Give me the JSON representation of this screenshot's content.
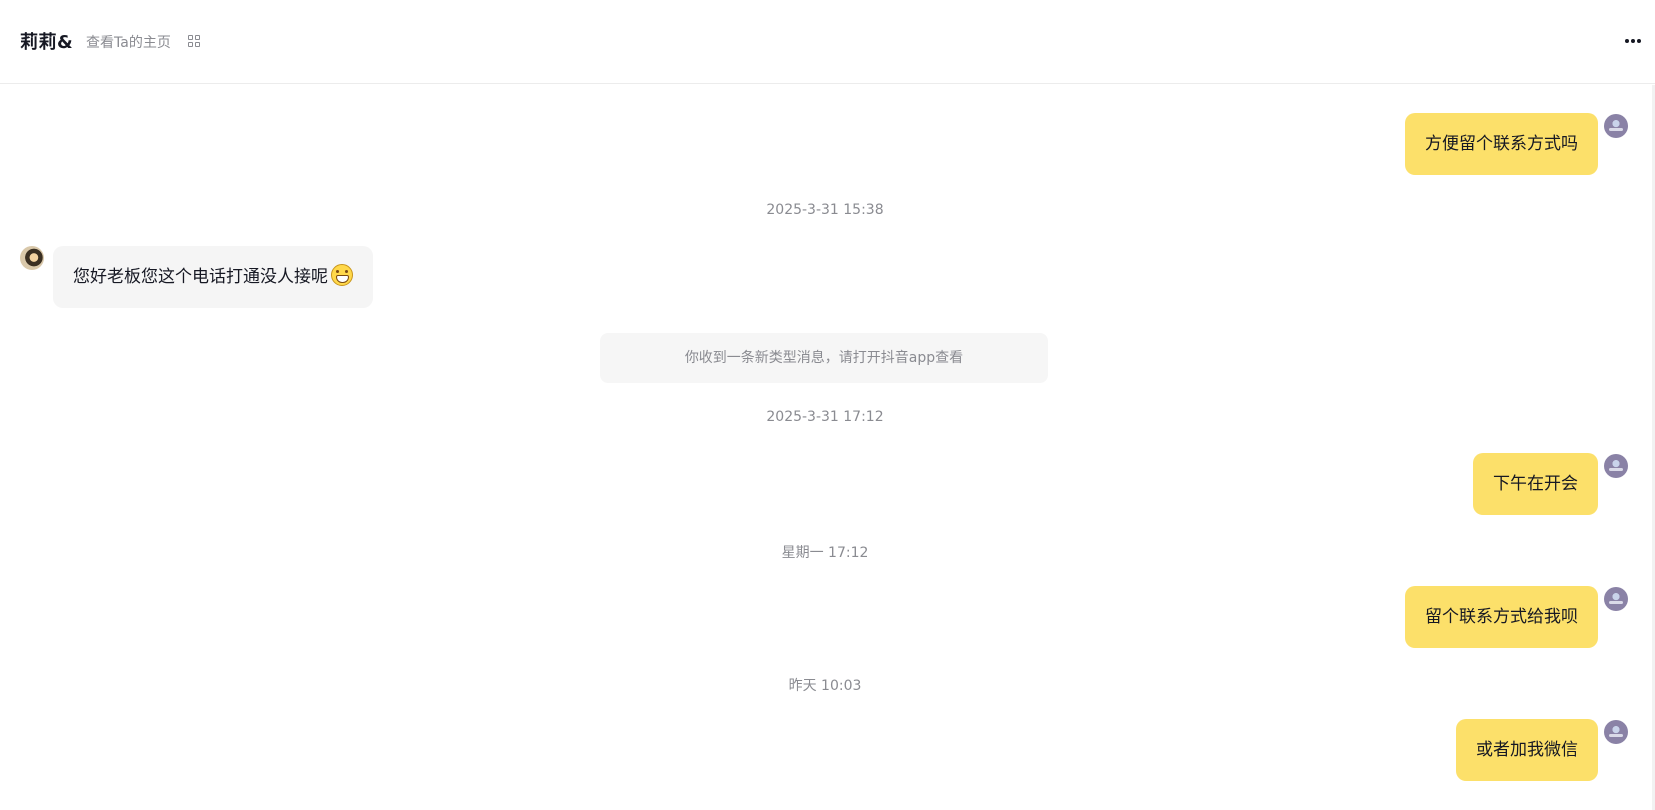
{
  "header": {
    "contact_name": "莉莉&",
    "profile_link": "查看Ta的主页"
  },
  "messages": [
    {
      "type": "sent",
      "text": "方便留个联系方式吗"
    },
    {
      "type": "timestamp",
      "text": "2025-3-31 15:38"
    },
    {
      "type": "received",
      "text": "您好老板您这个电话打通没人接呢",
      "emoji": "grinning-face-emoji"
    },
    {
      "type": "system",
      "text": "你收到一条新类型消息，请打开抖音app查看"
    },
    {
      "type": "timestamp",
      "text": "2025-3-31 17:12"
    },
    {
      "type": "sent",
      "text": "下午在开会"
    },
    {
      "type": "timestamp",
      "text": "星期一 17:12"
    },
    {
      "type": "sent",
      "text": "留个联系方式给我呗"
    },
    {
      "type": "timestamp",
      "text": "昨天 10:03"
    },
    {
      "type": "sent",
      "text": "或者加我微信"
    }
  ],
  "icons": {
    "qr": "qr-code-icon",
    "more": "more-options-icon"
  },
  "colors": {
    "sent_bubble": "#fce06a",
    "received_bubble": "#f5f5f5",
    "system_notice": "#f6f6f6",
    "timestamp_text": "#8a8b91"
  }
}
